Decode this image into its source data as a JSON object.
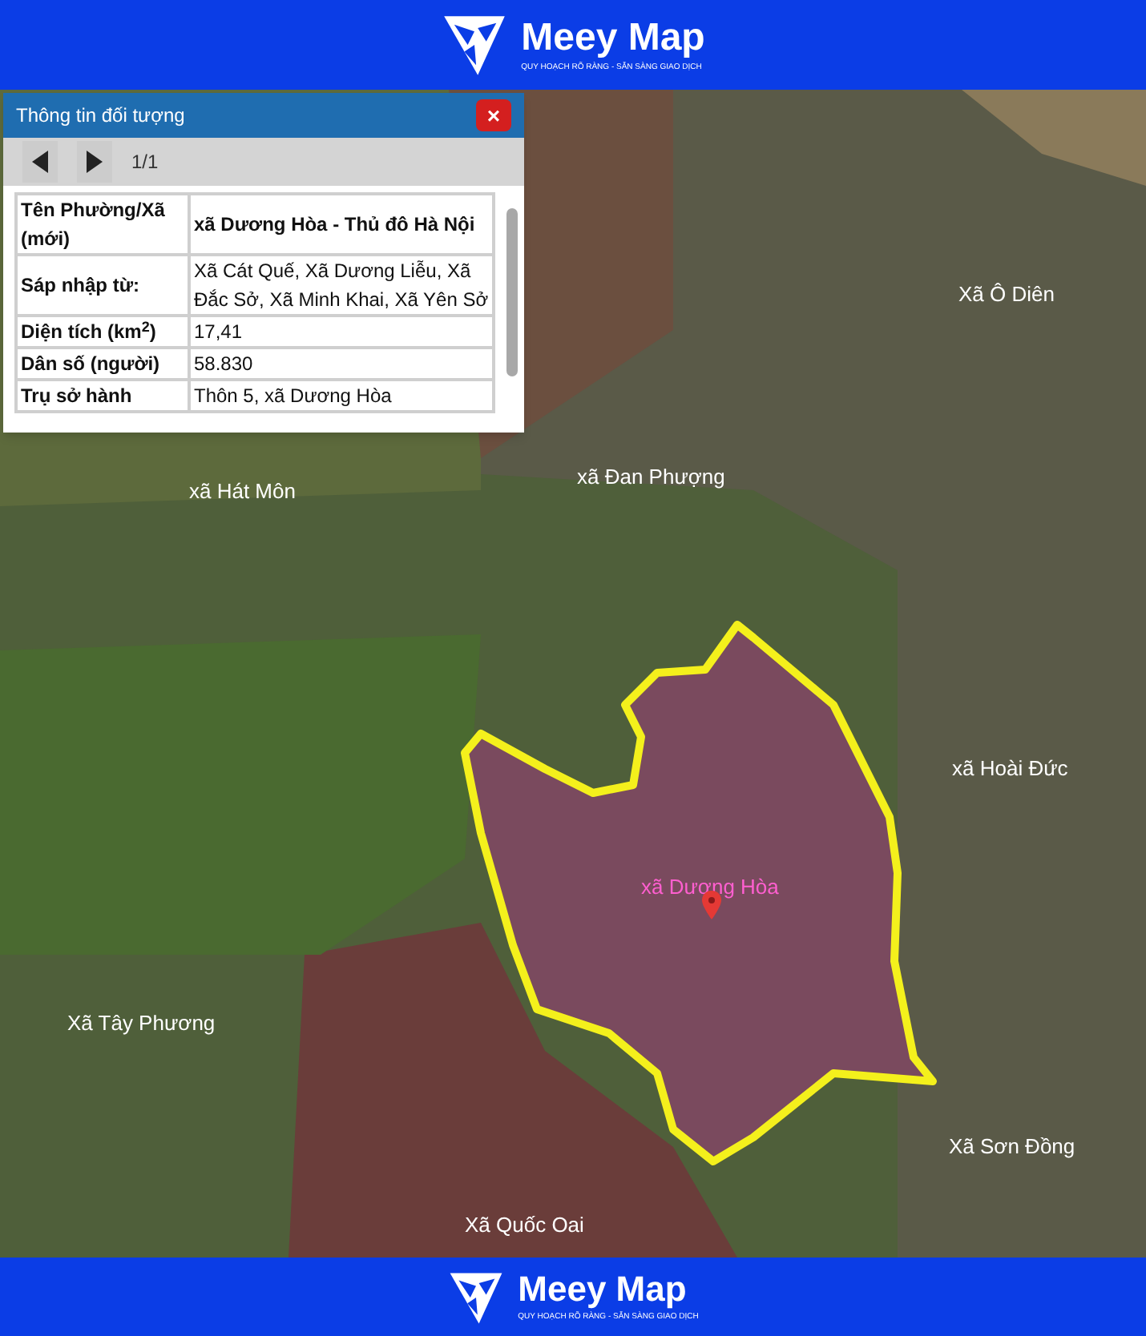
{
  "header": {
    "brand": "Meey Map",
    "tagline": "QUY HOẠCH RÕ RÀNG - SẴN SÀNG GIAO DỊCH"
  },
  "popup": {
    "title": "Thông tin đối tượng",
    "close": "×",
    "pager": "1/1",
    "rows": [
      {
        "label": "Tên Phường/Xã (mới)",
        "value": "xã Dương Hòa - Thủ đô Hà Nội",
        "bold": true
      },
      {
        "label": "Sáp nhập từ:",
        "value": "Xã Cát Quế, Xã Dương Liễu, Xã Đắc Sở, Xã Minh Khai, Xã Yên Sở",
        "bold": false
      },
      {
        "label": "Diện tích (km$^{2}$)",
        "value": "17,41",
        "bold": false
      },
      {
        "label": "Dân số (người)",
        "value": "58.830",
        "bold": false
      },
      {
        "label": "Trụ sở hành",
        "value": "Thôn 5, xã Dương Hòa",
        "bold": false
      }
    ]
  },
  "map": {
    "labels": [
      {
        "text": "Xã Ô Diên",
        "kind": "commune"
      },
      {
        "text": "xã Đan Phượng",
        "kind": "commune"
      },
      {
        "text": "xã Hát Môn",
        "kind": "commune"
      },
      {
        "text": "xã Hoài Đức",
        "kind": "commune"
      },
      {
        "text": "xã Dương Hòa",
        "kind": "selected"
      },
      {
        "text": "Xã Tây Phương",
        "kind": "commune"
      },
      {
        "text": "Xã Sơn Đồng",
        "kind": "commune"
      },
      {
        "text": "Xã Quốc Oai",
        "kind": "commune"
      }
    ]
  },
  "footer": {
    "brand": "Meey Map",
    "tagline": "QUY HOẠCH RÕ RÀNG - SẴN SÀNG GIAO DỊCH"
  }
}
